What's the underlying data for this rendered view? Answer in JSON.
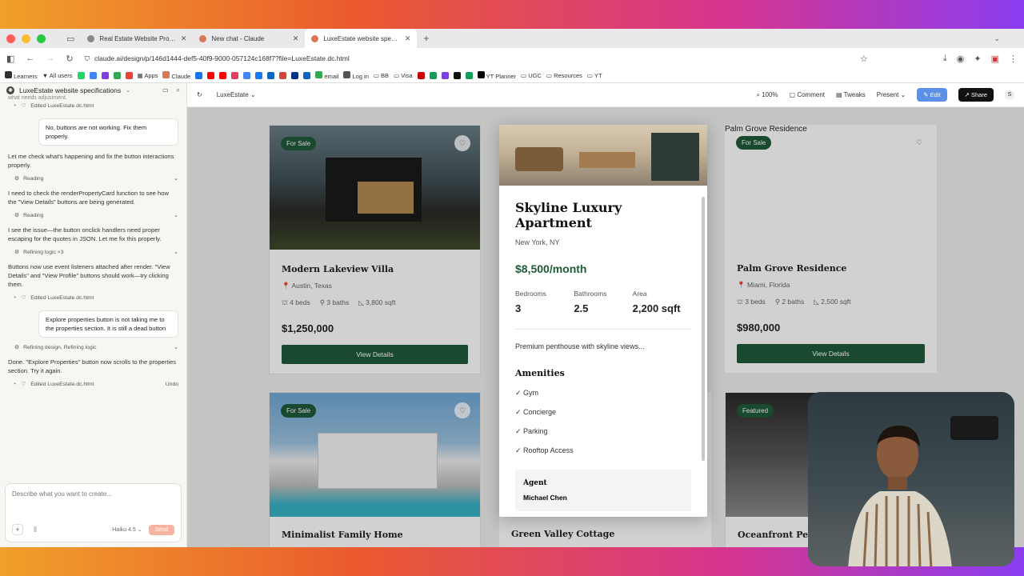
{
  "browser": {
    "tabs": [
      {
        "title": "Real Estate Website Prompt"
      },
      {
        "title": "New chat - Claude"
      },
      {
        "title": "LuxeEstate website specificatio"
      }
    ],
    "url": "claude.ai/design/p/146d1444-def5-40f9-9000-057124c168f7?file=LuxeEstate.dc.html",
    "bookmarks": [
      "Learners",
      "All users",
      "Apps",
      "Claude",
      "Log in",
      "BB",
      "Visa",
      "email",
      "YT Planner",
      "UGC",
      "Resources",
      "YT"
    ]
  },
  "sidebar": {
    "project_title": "LuxeEstate website specifications",
    "messages": {
      "cut_top": "what needs adjustment.",
      "edited_1": "Edited LuxeEstate.dc.html",
      "user_1": "No, buttons are not working. Fix them properly.",
      "ai_1": "Let me check what's happening and fix the button interactions properly.",
      "step_reading_1": "Reading",
      "ai_2": "I need to check the renderPropertyCard function to see how the \"View Details\" buttons are being generated.",
      "step_reading_2": "Reading",
      "ai_3": "I see the issue—the button onclick handlers need proper escaping for the quotes in JSON. Let me fix this properly.",
      "step_refining": "Refining logic ×3",
      "ai_4": "Buttons now use event listeners attached after render. \"View Details\" and \"View Profile\" buttons should work—try clicking them.",
      "edited_2": "Edited LuxeEstate.dc.html",
      "user_2": "Explore properties button is not taking me to the properties section. It is still a dead button",
      "step_refining_2": "Refining design, Refining logic",
      "ai_5": "Done. \"Explore Properties\" button now scrolls to the properties section. Try it again.",
      "edited_3": "Edited LuxeEstate.dc.html",
      "undo": "Undo"
    },
    "composer": {
      "placeholder": "Describe what you want to create...",
      "model": "Haiku 4.5",
      "send": "Send"
    }
  },
  "canvas_toolbar": {
    "file": "LuxeEstate",
    "zoom": "100%",
    "comment": "Comment",
    "tweaks": "Tweaks",
    "present": "Present",
    "edit": "Edit",
    "share": "Share",
    "user_initial": "S"
  },
  "cards": [
    {
      "badge": "For Sale",
      "name": "Modern Lakeview Villa",
      "loc": "Austin, Texas",
      "beds": "4 beds",
      "baths": "3 baths",
      "area": "3,800 sqft",
      "price": "$1,250,000",
      "button": "View Details"
    },
    {
      "badge": "For Sale",
      "name": "Palm Grove Residence",
      "loc": "Miami, Florida",
      "beds": "3 beds",
      "baths": "2 baths",
      "area": "2,500 sqft",
      "price": "$980,000",
      "button": "View Details",
      "alt_title": "Palm Grove Residence"
    },
    {
      "badge": "For Sale",
      "name": "Minimalist Family Home"
    },
    {
      "name": "Green Valley Cottage"
    },
    {
      "badge": "Featured",
      "name": "Oceanfront Pent"
    }
  ],
  "modal": {
    "title": "Skyline Luxury Apartment",
    "location": "New York, NY",
    "price": "$8,500/month",
    "stats": [
      {
        "label": "Bedrooms",
        "value": "3"
      },
      {
        "label": "Bathrooms",
        "value": "2.5"
      },
      {
        "label": "Area",
        "value": "2,200 sqft"
      }
    ],
    "description": "Premium penthouse with skyline views...",
    "amenities_heading": "Amenities",
    "amenities": [
      "✓ Gym",
      "✓ Concierge",
      "✓ Parking",
      "✓ Rooftop Access"
    ],
    "agent_heading": "Agent",
    "agent_name": "Michael Chen"
  }
}
